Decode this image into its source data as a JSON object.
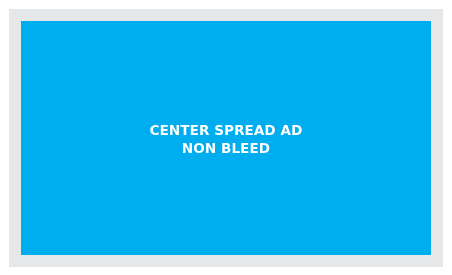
{
  "ad_placeholder": {
    "line1": "CENTER SPREAD AD",
    "line2": "NON BLEED",
    "panel_color": "#00aeef",
    "frame_color": "#e6e7e8",
    "text_color": "#ffffff"
  }
}
